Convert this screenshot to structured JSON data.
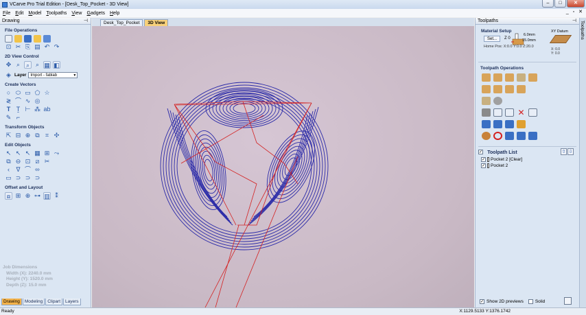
{
  "window": {
    "title": "VCarve Pro Trial Edition - [Desk_Top_Pocket - 3D View]"
  },
  "menu": [
    {
      "u": "F",
      "rest": "ile"
    },
    {
      "u": "E",
      "rest": "dit"
    },
    {
      "u": "M",
      "rest": "odel"
    },
    {
      "u": "T",
      "rest": "oolpaths"
    },
    {
      "u": "V",
      "rest": "iew"
    },
    {
      "u": "G",
      "rest": "adgets"
    },
    {
      "u": "H",
      "rest": "elp"
    }
  ],
  "left": {
    "panel_title": "Drawing",
    "sections": {
      "file_operations": "File Operations",
      "view_control": "2D View Control",
      "create_vectors": "Create Vectors",
      "transform": "Transform Objects",
      "edit": "Edit Objects",
      "offset": "Offset and Layout"
    },
    "layer_label": "Layer",
    "layer_value": "Import - fablab",
    "job": {
      "title": "Job Dimensions",
      "width": "Width  (X): 2240.0 mm",
      "height": "Height (Y): 1520.0 mm",
      "depth": "Depth  (Z): 15.0 mm"
    },
    "tabs": [
      "Drawing",
      "Modeling",
      "Clipart",
      "Layers"
    ]
  },
  "view_tabs": [
    "Desk_Top_Pocket",
    "3D View"
  ],
  "right": {
    "panel_title": "Toolpaths",
    "material_setup": "Material Setup",
    "set_button": "Set...",
    "z_zero": "Z 0",
    "thickness_top": "6.0mm",
    "thickness": "15.0mm",
    "home_pos": "Home Pos:  X:0.0 Y:0.0 Z:20.0",
    "xy_datum": "XY Datum",
    "xy_values": "X: 0.0",
    "xy_values2": "Y: 0.0",
    "ops_title": "Toolpath Operations",
    "list_title": "Toolpath List",
    "items": [
      "Pocket 2 [Clear]",
      "Pocket 2"
    ],
    "show_2d": "Show 2D previews",
    "solid": "Solid",
    "strip_label": "Toolpaths"
  },
  "status": {
    "left": "Ready",
    "coords": "X:1129.5133 Y:1376.1742"
  },
  "colors": {
    "accent": "#f5b34a",
    "panel": "#dbe6f3",
    "toolpath": "#2a2aa8",
    "rapid": "#d42020"
  }
}
